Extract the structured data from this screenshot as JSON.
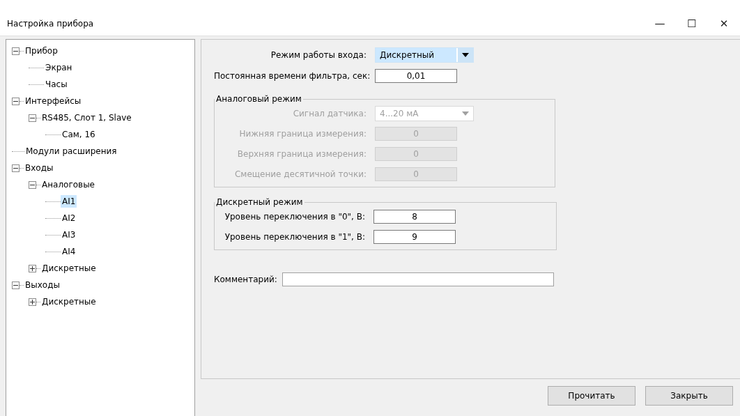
{
  "window": {
    "title": "Настройка прибора",
    "controls": [
      "—",
      "☐",
      "✕"
    ]
  },
  "tree": [
    {
      "label": "Прибор",
      "expanded": true,
      "selected": false,
      "children": [
        {
          "label": "Экран",
          "selected": false
        },
        {
          "label": "Часы",
          "selected": false
        }
      ]
    },
    {
      "label": "Интерфейсы",
      "expanded": true,
      "selected": false,
      "children": [
        {
          "label": "RS485, Слот 1, Slave",
          "expanded": true,
          "selected": false,
          "children": [
            {
              "label": "Сам, 16",
              "selected": false
            }
          ]
        }
      ]
    },
    {
      "label": "Модули расширения",
      "selected": false
    },
    {
      "label": "Входы",
      "expanded": true,
      "selected": false,
      "children": [
        {
          "label": "Аналоговые",
          "expanded": true,
          "selected": false,
          "children": [
            {
              "label": "AI1",
              "selected": true
            },
            {
              "label": "AI2",
              "selected": false
            },
            {
              "label": "AI3",
              "selected": false
            },
            {
              "label": "AI4",
              "selected": false
            }
          ]
        },
        {
          "label": "Дискретные",
          "expanded": false,
          "selected": false
        }
      ]
    },
    {
      "label": "Выходы",
      "expanded": true,
      "selected": false,
      "children": [
        {
          "label": "Дискретные",
          "expanded": false,
          "selected": false
        }
      ]
    }
  ],
  "form": {
    "top": [
      {
        "kind": "combo",
        "label": "Режим работы входа:",
        "value": "Дискретный",
        "focused": true,
        "disabled": false
      },
      {
        "kind": "field",
        "label": "Постоянная времени фильтра, сек:",
        "value": "0,01",
        "disabled": false
      }
    ],
    "groups": [
      {
        "title": "Аналоговый режим",
        "rows": [
          {
            "kind": "combo",
            "label": "Сигнал датчика:",
            "value": "4...20 мА",
            "focused": false,
            "disabled": true
          },
          {
            "kind": "field",
            "label": "Нижняя граница измерения:",
            "value": "0",
            "disabled": true
          },
          {
            "kind": "field",
            "label": "Верхняя граница измерения:",
            "value": "0",
            "disabled": true
          },
          {
            "kind": "field",
            "label": "Смещение десятичной точки:",
            "value": "0",
            "disabled": true
          }
        ]
      },
      {
        "title": "Дискретный режим",
        "rows": [
          {
            "kind": "field",
            "label": "Уровень переключения в \"0\", В:",
            "value": "8",
            "disabled": false
          },
          {
            "kind": "field",
            "label": "Уровень переключения в \"1\", В:",
            "value": "9",
            "disabled": false
          }
        ]
      }
    ],
    "comment": {
      "label": "Комментарий:"
    }
  },
  "buttons": [
    "Прочитать",
    "Закрыть"
  ]
}
